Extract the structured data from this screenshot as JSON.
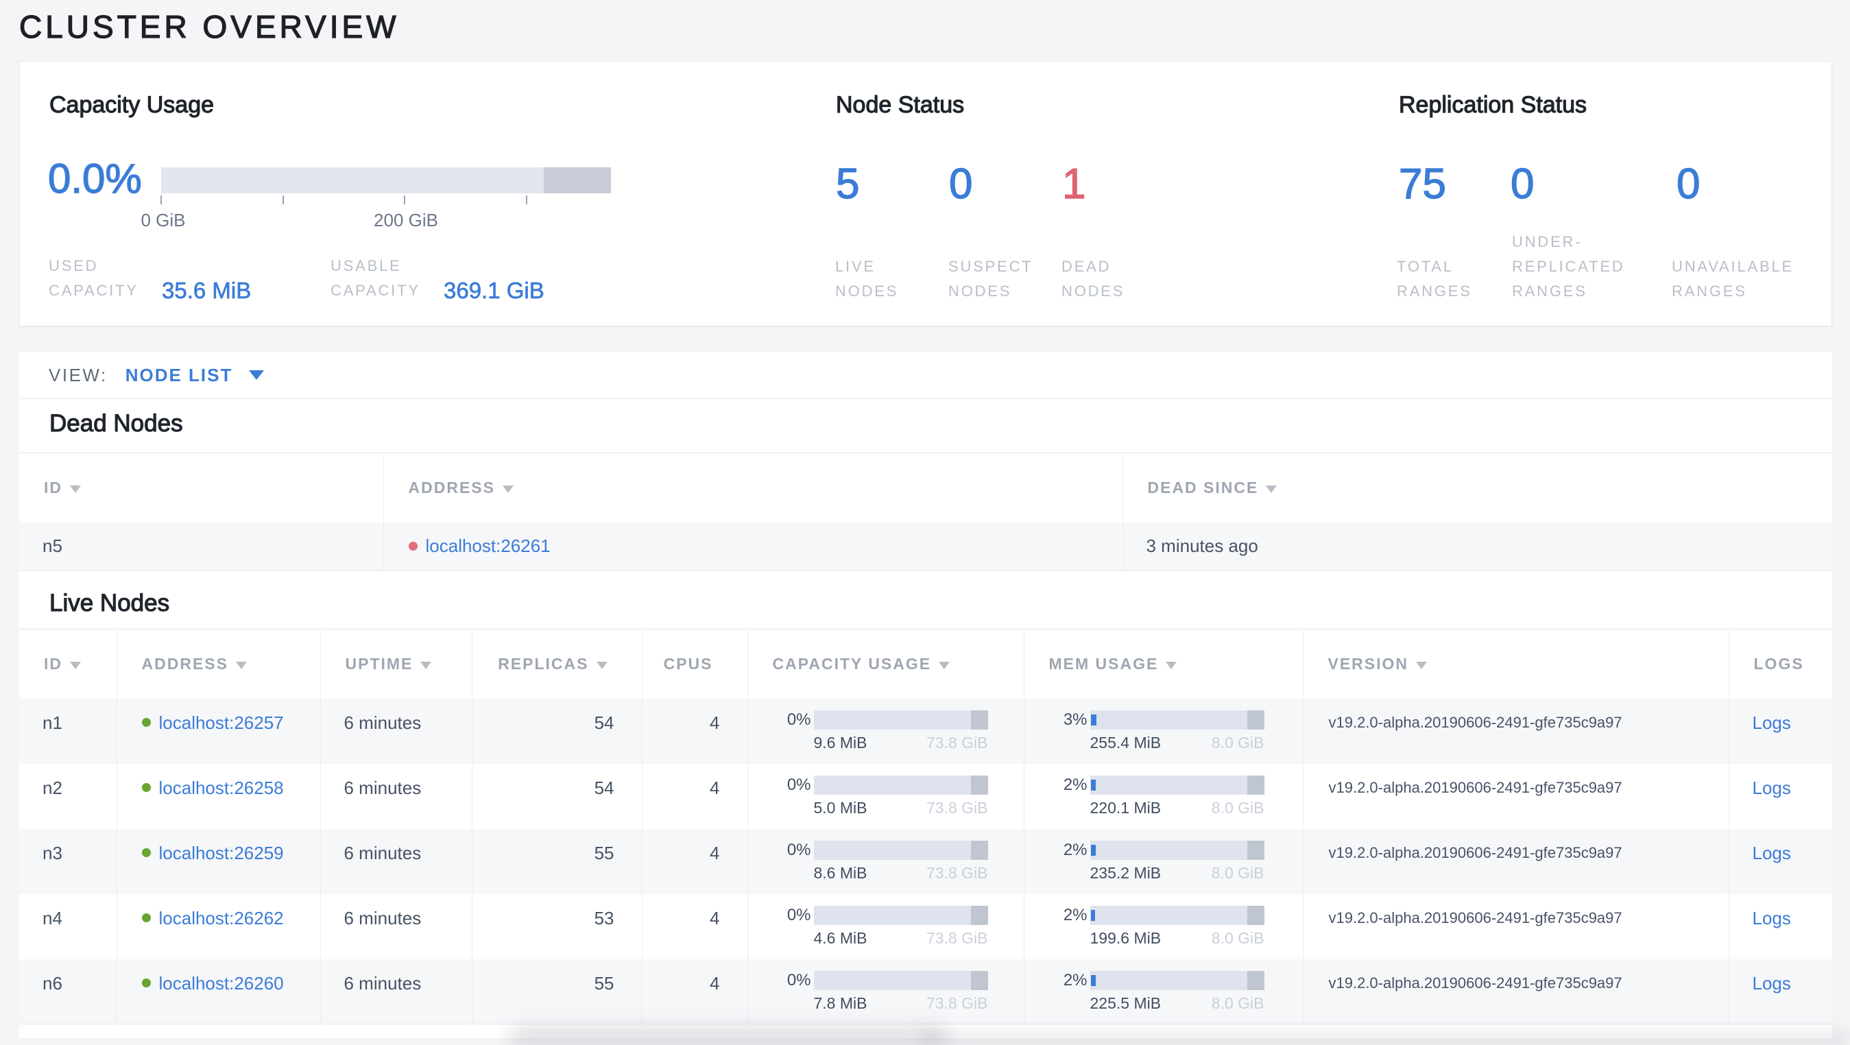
{
  "page_title": "CLUSTER OVERVIEW",
  "colors": {
    "accent_blue": "#3b7cd7",
    "dead_red": "#de6472",
    "live_green": "#68a52e",
    "page_background": "#f5f5f7",
    "card_background": "#ffffff"
  },
  "overview": {
    "capacity": {
      "title": "Capacity Usage",
      "percent_used": "0.0%",
      "axis_tick_labels": [
        "0 GiB",
        "200 GiB"
      ],
      "used_label": "USED\nCAPACITY",
      "used_value": "35.6 MiB",
      "usable_label": "USABLE\nCAPACITY",
      "usable_value": "369.1 GiB"
    },
    "node_status": {
      "title": "Node Status",
      "stats": [
        {
          "value": "5",
          "label": "LIVE\nNODES",
          "status": "normal"
        },
        {
          "value": "0",
          "label": "SUSPECT\nNODES",
          "status": "normal"
        },
        {
          "value": "1",
          "label": "DEAD\nNODES",
          "status": "dead"
        }
      ]
    },
    "replication_status": {
      "title": "Replication Status",
      "stats": [
        {
          "value": "75",
          "label": "TOTAL\nRANGES",
          "status": "normal"
        },
        {
          "value": "0",
          "label": "UNDER-\nREPLICATED\nRANGES",
          "status": "normal"
        },
        {
          "value": "0",
          "label": "UNAVAILABLE\nRANGES",
          "status": "normal"
        }
      ]
    }
  },
  "view_bar": {
    "label": "VIEW:",
    "selected": "NODE LIST"
  },
  "dead_nodes": {
    "title": "Dead Nodes",
    "columns": {
      "id": "ID",
      "address": "ADDRESS",
      "dead_since": "DEAD SINCE"
    },
    "rows": [
      {
        "id": "n5",
        "address": "localhost:26261",
        "dead_since": "3 minutes ago"
      }
    ]
  },
  "live_nodes": {
    "title": "Live Nodes",
    "columns": {
      "id": "ID",
      "address": "ADDRESS",
      "uptime": "UPTIME",
      "replicas": "REPLICAS",
      "cpus": "CPUS",
      "capacity": "CAPACITY USAGE",
      "memory": "MEM USAGE",
      "version": "VERSION",
      "logs": "LOGS"
    },
    "rows": [
      {
        "id": "n1",
        "address": "localhost:26257",
        "uptime": "6 minutes",
        "replicas": "54",
        "cpus": "4",
        "capacity": {
          "pct": "0%",
          "pct_num": 0,
          "used": "9.6 MiB",
          "total": "73.8 GiB"
        },
        "memory": {
          "pct": "3%",
          "pct_num": 3.1,
          "used": "255.4 MiB",
          "total": "8.0 GiB"
        },
        "version": "v19.2.0-alpha.20190606-2491-gfe735c9a97",
        "logs": "Logs"
      },
      {
        "id": "n2",
        "address": "localhost:26258",
        "uptime": "6 minutes",
        "replicas": "54",
        "cpus": "4",
        "capacity": {
          "pct": "0%",
          "pct_num": 0,
          "used": "5.0 MiB",
          "total": "73.8 GiB"
        },
        "memory": {
          "pct": "2%",
          "pct_num": 2.7,
          "used": "220.1 MiB",
          "total": "8.0 GiB"
        },
        "version": "v19.2.0-alpha.20190606-2491-gfe735c9a97",
        "logs": "Logs"
      },
      {
        "id": "n3",
        "address": "localhost:26259",
        "uptime": "6 minutes",
        "replicas": "55",
        "cpus": "4",
        "capacity": {
          "pct": "0%",
          "pct_num": 0,
          "used": "8.6 MiB",
          "total": "73.8 GiB"
        },
        "memory": {
          "pct": "2%",
          "pct_num": 2.9,
          "used": "235.2 MiB",
          "total": "8.0 GiB"
        },
        "version": "v19.2.0-alpha.20190606-2491-gfe735c9a97",
        "logs": "Logs"
      },
      {
        "id": "n4",
        "address": "localhost:26262",
        "uptime": "6 minutes",
        "replicas": "53",
        "cpus": "4",
        "capacity": {
          "pct": "0%",
          "pct_num": 0,
          "used": "4.6 MiB",
          "total": "73.8 GiB"
        },
        "memory": {
          "pct": "2%",
          "pct_num": 2.4,
          "used": "199.6 MiB",
          "total": "8.0 GiB"
        },
        "version": "v19.2.0-alpha.20190606-2491-gfe735c9a97",
        "logs": "Logs"
      },
      {
        "id": "n6",
        "address": "localhost:26260",
        "uptime": "6 minutes",
        "replicas": "55",
        "cpus": "4",
        "capacity": {
          "pct": "0%",
          "pct_num": 0,
          "used": "7.8 MiB",
          "total": "73.8 GiB"
        },
        "memory": {
          "pct": "2%",
          "pct_num": 2.8,
          "used": "225.5 MiB",
          "total": "8.0 GiB"
        },
        "version": "v19.2.0-alpha.20190606-2491-gfe735c9a97",
        "logs": "Logs"
      }
    ]
  }
}
